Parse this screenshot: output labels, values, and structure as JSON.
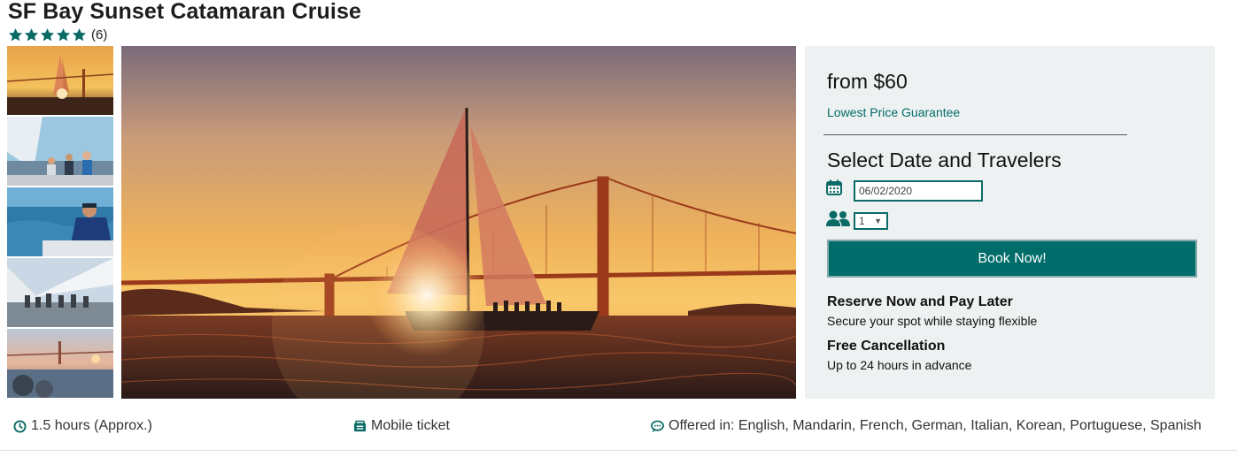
{
  "product": {
    "title": "SF Bay Sunset Catamaran Cruise",
    "rating_stars": 5,
    "review_count": "(6)"
  },
  "gallery": {
    "thumbnails": [
      "sunset-sail",
      "crew-sailing",
      "captain-at-helm",
      "passengers-on-deck",
      "golden-gate-sunset"
    ],
    "main_image": "catamaran-sunset-golden-gate"
  },
  "booking": {
    "price": "from $60",
    "guarantee": "Lowest Price Guarantee",
    "section_title": "Select Date and Travelers",
    "date_value": "06/02/2020",
    "travelers_value": "1",
    "book_label": "Book Now!",
    "features": [
      {
        "title": "Reserve Now and Pay Later",
        "text": "Secure your spot while staying flexible"
      },
      {
        "title": "Free Cancellation",
        "text": "Up to 24 hours in advance"
      }
    ]
  },
  "info": {
    "duration": "1.5 hours (Approx.)",
    "ticket": "Mobile ticket",
    "languages": "Offered in: English, Mandarin, French, German, Italian, Korean, Portuguese, Spanish"
  },
  "colors": {
    "accent": "#006d6a",
    "panel_bg": "#eef1f2"
  }
}
